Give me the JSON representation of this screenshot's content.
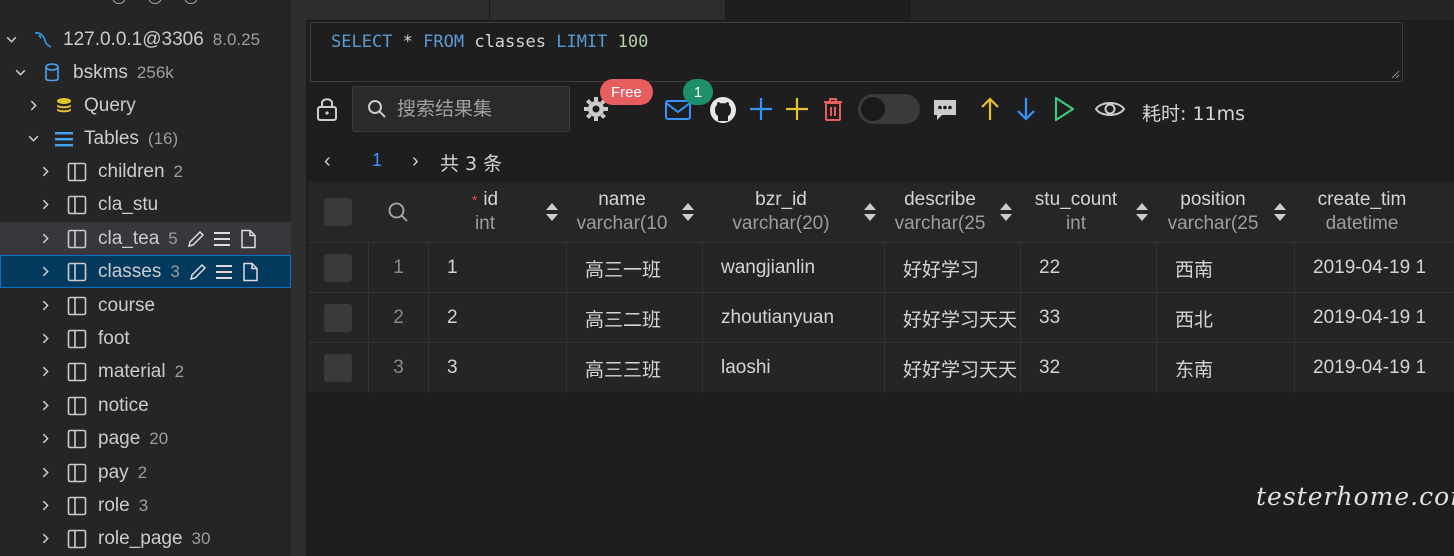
{
  "sidebar": {
    "connection": {
      "name": "127.0.0.1@3306",
      "version": "8.0.25"
    },
    "database": {
      "name": "bskms",
      "size": "256k"
    },
    "query_label": "Query",
    "tables_label": "Tables",
    "tables_count": "(16)",
    "tables": [
      {
        "name": "children",
        "count": "2"
      },
      {
        "name": "cla_stu",
        "count": ""
      },
      {
        "name": "cla_tea",
        "count": "5"
      },
      {
        "name": "classes",
        "count": "3"
      },
      {
        "name": "course",
        "count": ""
      },
      {
        "name": "foot",
        "count": ""
      },
      {
        "name": "material",
        "count": "2"
      },
      {
        "name": "notice",
        "count": ""
      },
      {
        "name": "page",
        "count": "20"
      },
      {
        "name": "pay",
        "count": "2"
      },
      {
        "name": "role",
        "count": "3"
      },
      {
        "name": "role_page",
        "count": "30"
      }
    ]
  },
  "editor": {
    "sql": {
      "kw1": "SELECT",
      "star": " * ",
      "kw2": "FROM",
      "table": " classes ",
      "kw3": "LIMIT",
      "limit": " 100"
    }
  },
  "toolbar": {
    "search_placeholder": "搜索结果集",
    "free_badge": "Free",
    "mail_badge": "1",
    "elapsed": "耗时: 11ms"
  },
  "pager": {
    "prev": "‹",
    "page": "1",
    "next": "›",
    "total": "共 3 条"
  },
  "grid": {
    "columns": [
      {
        "name": "id",
        "type": "int",
        "required": true
      },
      {
        "name": "name",
        "type": "varchar(10",
        "required": false
      },
      {
        "name": "bzr_id",
        "type": "varchar(20)",
        "required": false
      },
      {
        "name": "describe",
        "type": "varchar(25",
        "required": false
      },
      {
        "name": "stu_count",
        "type": "int",
        "required": false
      },
      {
        "name": "position",
        "type": "varchar(25",
        "required": false
      },
      {
        "name": "create_tim",
        "type": "datetime",
        "required": false
      }
    ],
    "rows": [
      {
        "n": "1",
        "cells": [
          "1",
          "高三一班",
          "wangjianlin",
          "好好学习",
          "22",
          "西南",
          "2019-04-19 1"
        ]
      },
      {
        "n": "2",
        "cells": [
          "2",
          "高三二班",
          "zhoutianyuan",
          "好好学习天天",
          "33",
          "西北",
          "2019-04-19 1"
        ]
      },
      {
        "n": "3",
        "cells": [
          "3",
          "高三三班",
          "laoshi",
          "好好学习天天",
          "32",
          "东南",
          "2019-04-19 1"
        ]
      }
    ]
  },
  "watermark": "testerhome.com",
  "colors": {
    "accent": "#3794ff",
    "selection": "#04395e",
    "free_badge": "#e85d5d",
    "mail_badge": "#1e8f6b"
  }
}
